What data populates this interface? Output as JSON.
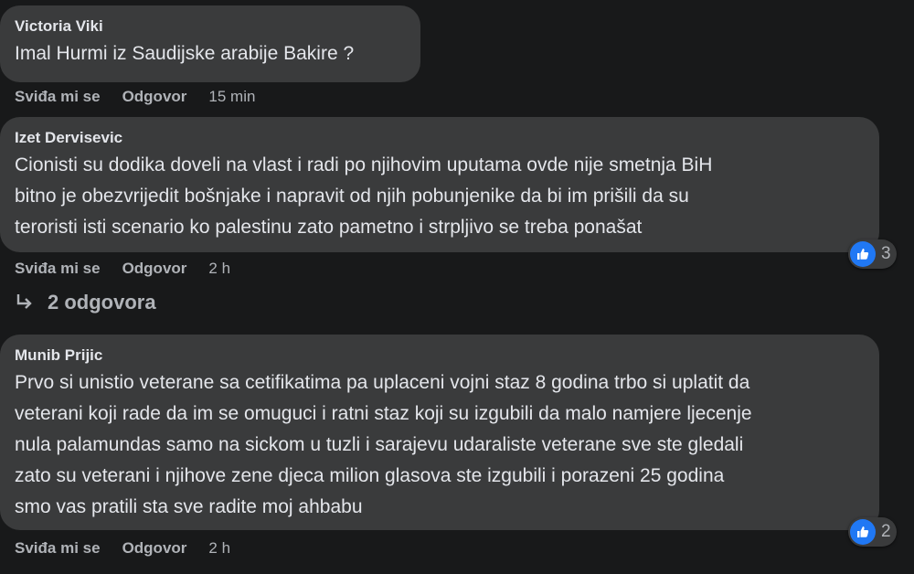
{
  "comments": [
    {
      "author": "Victoria Viki",
      "text": "Imal Hurmi iz Saudijske arabije Bakire ?",
      "like_label": "Sviđa mi se",
      "reply_label": "Odgovor",
      "time": "15 min",
      "reaction_count": null
    },
    {
      "author": "Izet Dervisevic",
      "text_lines": [
        "Cionisti su dodika doveli na vlast i radi po njihovim uputama ovde nije smetnja BiH",
        "bitno je obezvrijedit bošnjake i napravit od njih pobunjenike da bi im prišili da su",
        "teroristi isti scenario ko palestinu zato pametno i strpljivo se treba ponašat"
      ],
      "like_label": "Sviđa mi se",
      "reply_label": "Odgovor",
      "time": "2 h",
      "reaction_count": "3"
    },
    {
      "author": "Munib Prijic",
      "text_lines": [
        "Prvo si unistio veterane sa cetifikatima pa uplaceni vojni staz 8 godina trbo si uplatit da",
        "veterani koji rade da im se omuguci i ratni staz koji su izgubili da malo namjere ljecenje",
        "nula palamundas samo na sickom u tuzli i sarajevu udaraliste veterane sve ste gledali",
        "zato su veterani i njihove zene djeca milion glasova ste izgubili i porazeni 25 godina",
        "smo vas pratili sta sve radite moj ahbabu"
      ],
      "like_label": "Sviđa mi se",
      "reply_label": "Odgovor",
      "time": "2 h",
      "reaction_count": "2"
    }
  ],
  "replies_link": "2 odgovora",
  "icons": {
    "reaction": "like-thumb-icon",
    "replies": "reply-arrow-icon"
  },
  "colors": {
    "background": "#18191a",
    "bubble": "#3a3b3c",
    "text": "#e4e6eb",
    "secondary": "#b0b3b8",
    "like_blue": "#2078f4"
  }
}
